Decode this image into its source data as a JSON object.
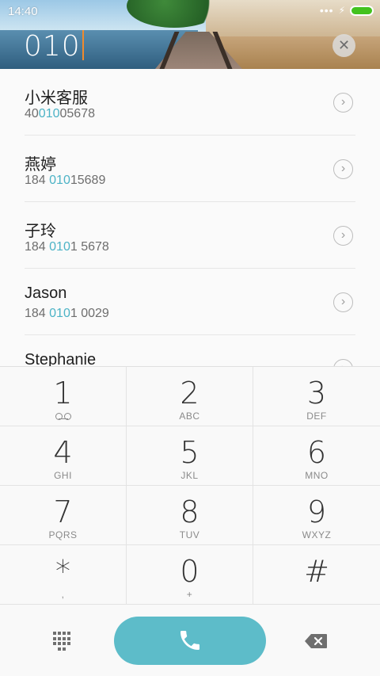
{
  "status": {
    "time": "14:40",
    "battery_color": "#43c21e"
  },
  "dialer": {
    "input": "010",
    "caret_color": "#f08a2d",
    "highlight_color": "#4cb3c6"
  },
  "contacts": [
    {
      "name": "小米客服",
      "pre": "40",
      "match": "010",
      "post": "05678"
    },
    {
      "name": "燕婷",
      "pre": "184 ",
      "match": "010",
      "post": "15689"
    },
    {
      "name": "子玲",
      "pre": "184 ",
      "match": "010",
      "post": "1 5678"
    },
    {
      "name": "Jason",
      "pre": "184 ",
      "match": "010",
      "post": "1 0029"
    },
    {
      "name": "Stephanie",
      "pre": "",
      "match": "",
      "post": ""
    }
  ],
  "keypad": [
    {
      "digit": "1",
      "sub": "",
      "icon": "voicemail-icon"
    },
    {
      "digit": "2",
      "sub": "ABC"
    },
    {
      "digit": "3",
      "sub": "DEF"
    },
    {
      "digit": "4",
      "sub": "GHI"
    },
    {
      "digit": "5",
      "sub": "JKL"
    },
    {
      "digit": "6",
      "sub": "MNO"
    },
    {
      "digit": "7",
      "sub": "PQRS"
    },
    {
      "digit": "8",
      "sub": "TUV"
    },
    {
      "digit": "9",
      "sub": "WXYZ"
    },
    {
      "digit": "*",
      "sub": ","
    },
    {
      "digit": "0",
      "sub": "+"
    },
    {
      "digit": "#",
      "sub": ""
    }
  ],
  "bottom": {
    "call_color": "#5dbcc9",
    "icons": [
      "dialpad-icon",
      "phone-icon",
      "backspace-icon"
    ]
  }
}
